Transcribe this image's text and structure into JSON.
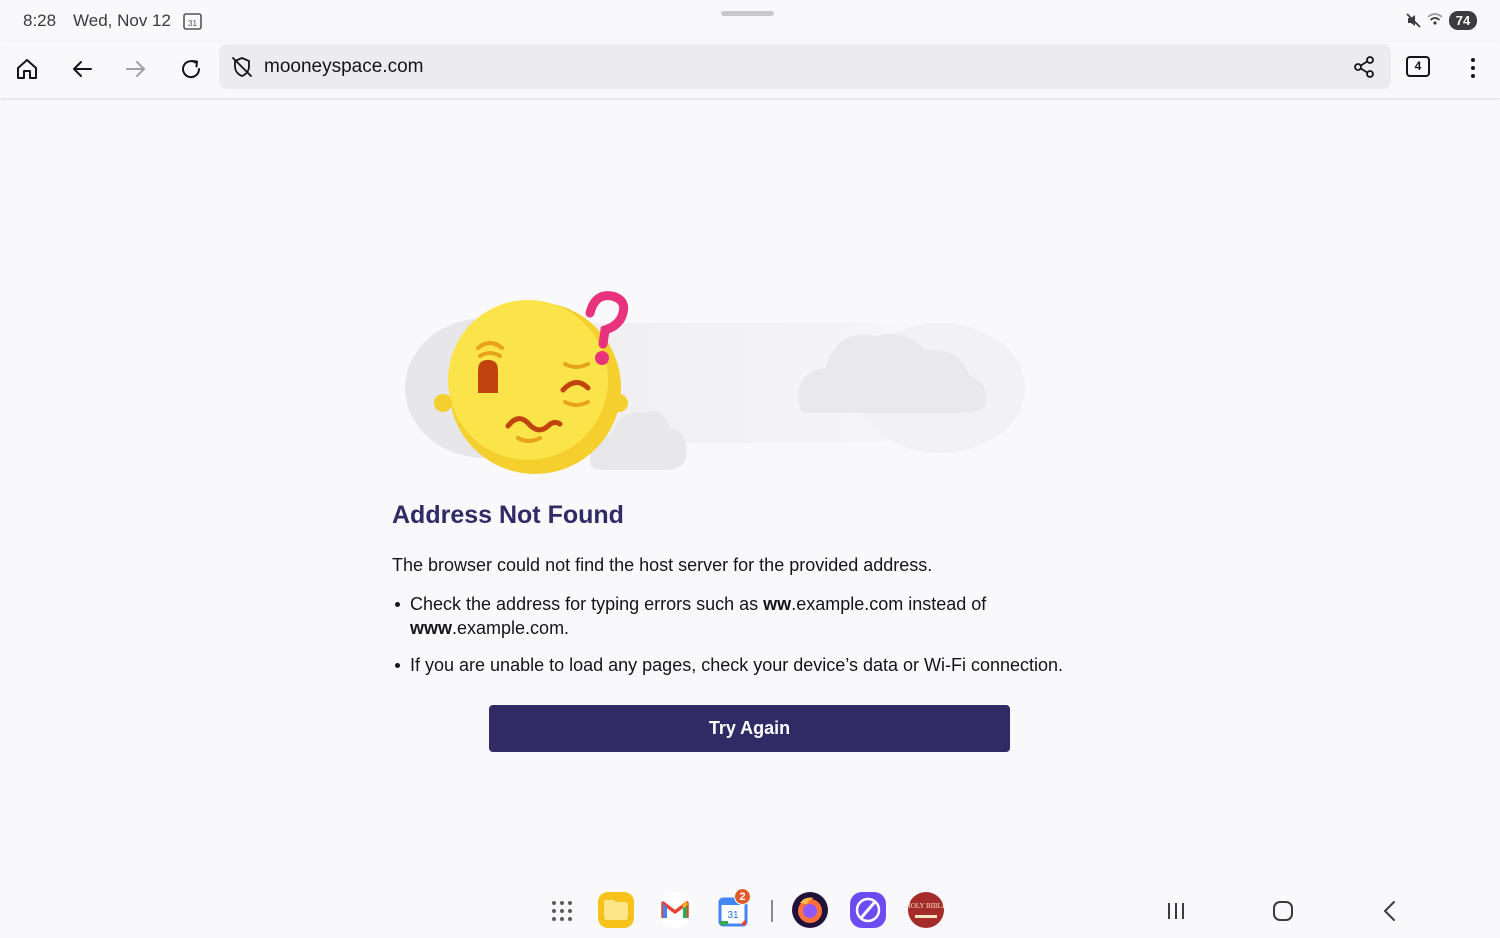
{
  "status_bar": {
    "time": "8:28",
    "date": "Wed, Nov 12",
    "calendar_day": "31",
    "battery": "74"
  },
  "toolbar": {
    "url": "mooneyspace.com",
    "tab_count": "4",
    "icons": [
      "home-icon",
      "back-icon",
      "forward-icon",
      "reload-icon",
      "shield-off-icon",
      "share-icon",
      "tabs-icon",
      "menu-icon"
    ]
  },
  "error_page": {
    "title": "Address Not Found",
    "description": "The browser could not find the host server for the provided address.",
    "tip1": {
      "pre": "Check the address for typing errors such as ",
      "bold1": "ww",
      "mid": ".example.com instead of ",
      "bold2": "www",
      "post": ".example.com."
    },
    "tip2": "If you are unable to load any pages, check your device’s data or Wi-Fi connection.",
    "button_label": "Try Again"
  },
  "taskbar": {
    "apps": [
      "app-drawer",
      "my-files",
      "gmail",
      "google-calendar",
      "firefox",
      "browser",
      "holy-bible"
    ],
    "calendar_badge": "2",
    "calendar_date": "31",
    "bible_label": "HOLY BIBLE"
  },
  "colors": {
    "accent": "#312a65",
    "background": "#f9f9fb",
    "urlbar": "#ececee"
  }
}
